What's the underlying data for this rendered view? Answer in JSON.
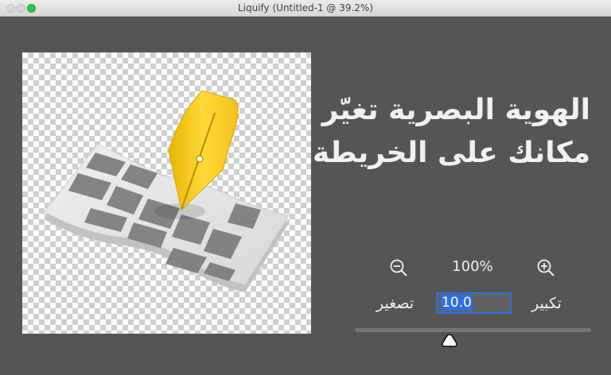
{
  "window": {
    "title": "Liquify (Untitled-1 @ 39.2%)"
  },
  "artwork": {
    "headline_line1": "الهوية البصرية تغيّر",
    "headline_line2": "مكانك على الخريطة",
    "accent_color": "#f5cc1f"
  },
  "zoom": {
    "level": "100%",
    "zoom_out_icon": "magnifier-minus-icon",
    "zoom_in_icon": "magnifier-plus-icon"
  },
  "brush": {
    "shrink_label": "تصغير",
    "enlarge_label": "تكبير",
    "value": "10.0",
    "slider_fraction": 0.4
  }
}
